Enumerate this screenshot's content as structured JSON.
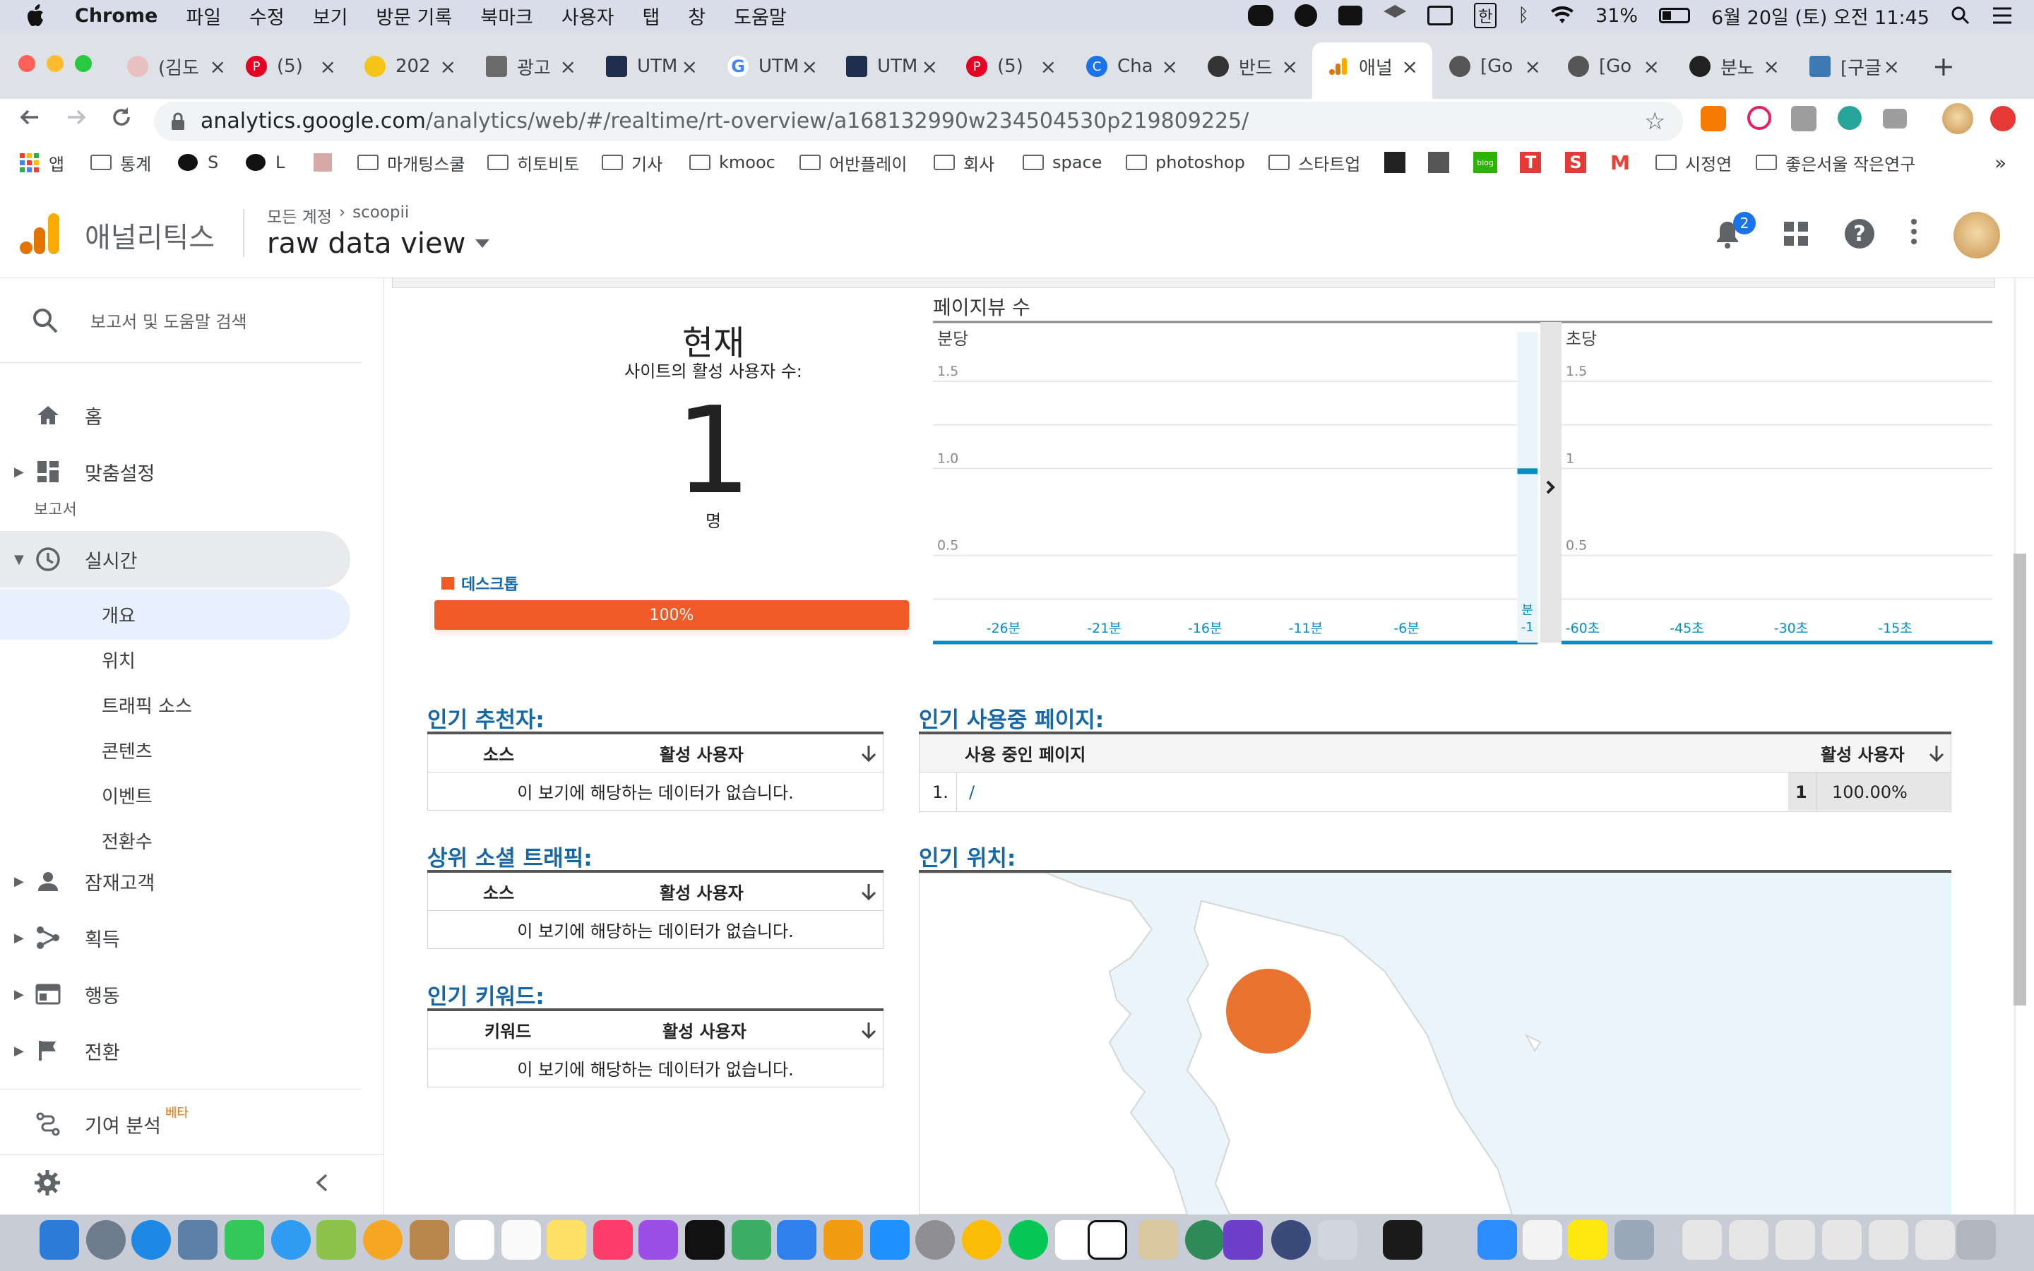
{
  "menubar": {
    "apple": "",
    "app": "Chrome",
    "menus": [
      "파일",
      "수정",
      "보기",
      "방문 기록",
      "북마크",
      "사용자",
      "탭",
      "창",
      "도움말"
    ],
    "battery": "31%",
    "ime": "한",
    "datetime": "6월 20일 (토) 오전 11:45"
  },
  "tabs": [
    {
      "label": "(김도",
      "color": "#e8c0c0"
    },
    {
      "label": "(5)",
      "color": "#e60023"
    },
    {
      "label": "202",
      "color": "#f5c518"
    },
    {
      "label": "광고",
      "color": "#6b6b6b"
    },
    {
      "label": "UTM",
      "color": "#1f2d4f"
    },
    {
      "label": "UTM",
      "color": "#4285f4"
    },
    {
      "label": "UTM",
      "color": "#1f2d4f"
    },
    {
      "label": "(5)",
      "color": "#e60023"
    },
    {
      "label": "Cha",
      "color": "#1a73e8"
    },
    {
      "label": "반드",
      "color": "#333333"
    },
    {
      "label": "애널",
      "color": "#f9ab00"
    },
    {
      "label": "[Go",
      "color": "#555555"
    },
    {
      "label": "[Go",
      "color": "#555555"
    },
    {
      "label": "분노",
      "color": "#222222"
    },
    {
      "label": "[구글",
      "color": "#3d7ab5"
    }
  ],
  "toolbar": {
    "url_host": "analytics.google.com",
    "url_path": "/analytics/web/#/realtime/rt-overview/a168132990w234504530p219809225/"
  },
  "bookmarks": [
    "앱",
    "통계",
    "S",
    "L",
    "",
    "마개팅스쿨",
    "히토비토",
    "기사",
    "kmooc",
    "어반플레이",
    "회사",
    "space",
    "photoshop",
    "스타트업",
    "",
    "",
    "blog",
    "T",
    "S",
    "",
    "시정연",
    "좋은서울 작은연구"
  ],
  "ga": {
    "product": "애널리틱스",
    "breadcrumb_root": "모든 계정",
    "breadcrumb_account": "scoopii",
    "view_name": "raw data view",
    "notif_count": "2"
  },
  "sidebar": {
    "search_placeholder": "보고서 및 도움말 검색",
    "home": "홈",
    "customize": "맞춤설정",
    "reports_header": "보고서",
    "realtime": "실시간",
    "realtime_items": [
      "개요",
      "위치",
      "트래픽 소스",
      "콘텐츠",
      "이벤트",
      "전환수"
    ],
    "audience": "잠재고객",
    "acquisition": "획득",
    "behavior": "행동",
    "conversions": "전환",
    "attribution": "기여 분석",
    "beta": "베타"
  },
  "realtime": {
    "now_title": "현재",
    "active_label": "사이트의 활성 사용자 수:",
    "active_count": "1",
    "unit": "명",
    "device_label": "데스크톱",
    "device_pct_text": "100%",
    "device_share": 1.0,
    "brand_orange": "#f05a28",
    "brand_blue": "#058dc7"
  },
  "pageviews": {
    "title": "페이지뷰 수",
    "per_minute_label": "분당",
    "per_second_label": "초당",
    "per_minute_chart": {
      "type": "bar",
      "ylim": [
        0,
        1.5
      ],
      "yticks": [
        "1.5",
        "1.0",
        "0.5"
      ],
      "xticks": [
        "-26분",
        "-21분",
        "-16분",
        "-11분",
        "-6분"
      ],
      "last_label_top": "분",
      "last_label_bottom": "-1",
      "values": {
        "-1": 1.0
      }
    },
    "per_second_chart": {
      "type": "bar",
      "ylim": [
        0,
        1.5
      ],
      "yticks": [
        "1.5",
        "1",
        "0.5"
      ],
      "xticks": [
        "-60초",
        "-45초",
        "-30초",
        "-15초"
      ],
      "values": {}
    }
  },
  "referrers": {
    "title": "인기 추천자:",
    "col1": "소스",
    "col2": "활성 사용자",
    "empty": "이 보기에 해당하는 데이터가 없습니다."
  },
  "social": {
    "title": "상위 소셜 트래픽:",
    "col1": "소스",
    "col2": "활성 사용자",
    "empty": "이 보기에 해당하는 데이터가 없습니다."
  },
  "keywords": {
    "title": "인기 키워드:",
    "col1": "키워드",
    "col2": "활성 사용자",
    "empty": "이 보기에 해당하는 데이터가 없습니다."
  },
  "active_pages": {
    "title": "인기 사용중 페이지:",
    "col1": "사용 중인 페이지",
    "col2": "활성 사용자",
    "rows": [
      {
        "rank": "1.",
        "page": "/",
        "users": "1",
        "pct": "100.00%"
      }
    ]
  },
  "locations": {
    "title": "인기 위치:"
  }
}
